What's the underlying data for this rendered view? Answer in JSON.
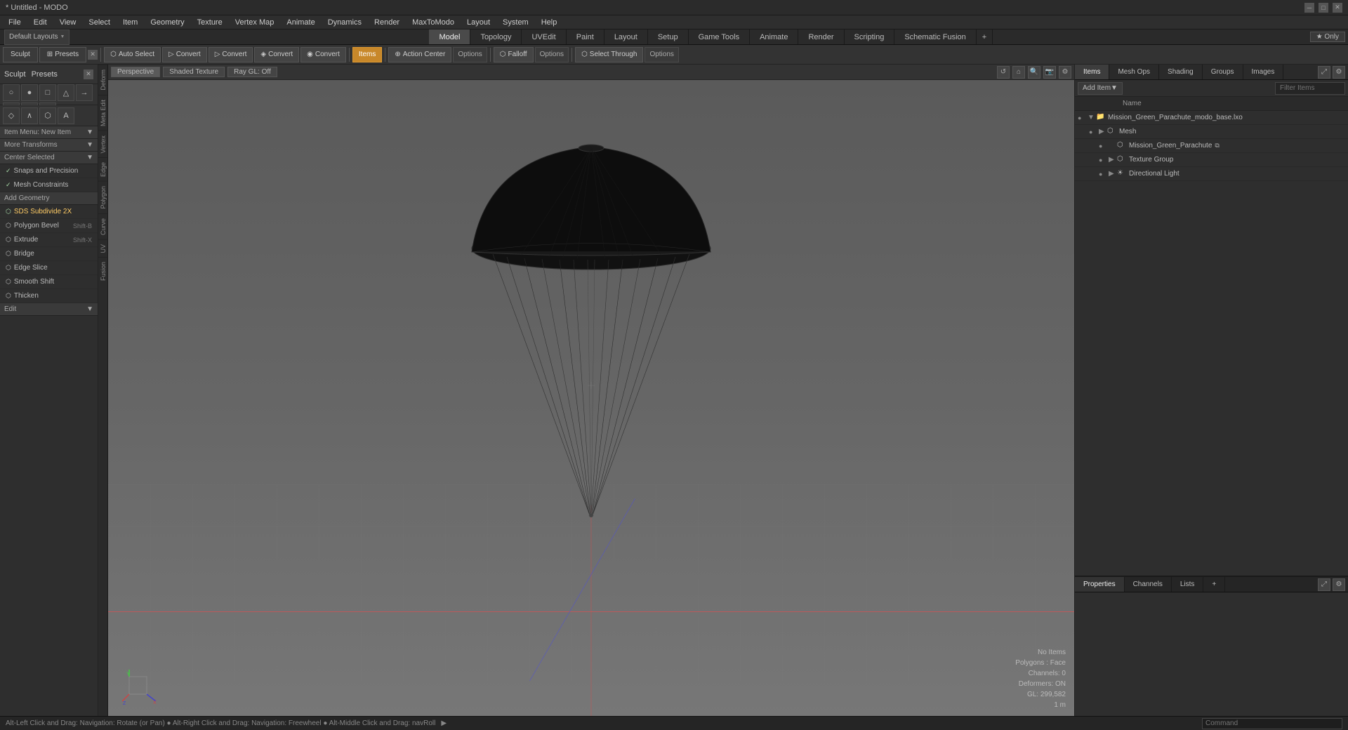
{
  "window": {
    "title": "* Untitled - MODO"
  },
  "menu": {
    "items": [
      "File",
      "Edit",
      "View",
      "Select",
      "Item",
      "Geometry",
      "Texture",
      "Vertex Map",
      "Animate",
      "Dynamics",
      "Render",
      "MaxToModo",
      "Layout",
      "System",
      "Help"
    ]
  },
  "main_tabs": {
    "items": [
      "Model",
      "Topology",
      "UVEdit",
      "Paint",
      "Layout",
      "Setup",
      "Game Tools",
      "Animate",
      "Render",
      "Scripting",
      "Schematic Fusion"
    ],
    "active": "Model",
    "add_btn": "+",
    "only_btn": "★  Only"
  },
  "toolbar": {
    "sculpt_label": "Sculpt",
    "presets_label": "Presets",
    "auto_select_label": "Auto Select",
    "convert_labels": [
      "Convert",
      "Convert",
      "Convert",
      "Convert"
    ],
    "items_label": "Items",
    "action_center_label": "Action Center",
    "options_label": "Options",
    "falloff_label": "Falloff",
    "options2_label": "Options",
    "select_through_label": "Select Through",
    "options3_label": "Options"
  },
  "viewport": {
    "tabs": [
      "Perspective",
      "Shaded Texture",
      "Ray GL: Off"
    ],
    "active_tab": "Perspective",
    "info": {
      "no_items": "No Items",
      "polygons": "Polygons : Face",
      "channels": "Channels: 0",
      "deformers": "Deformers: ON",
      "gl_coords": "GL: 299,582",
      "scale": "1 m"
    }
  },
  "left_sidebar": {
    "sculpt_header": "Sculpt",
    "presets_header": "Presets",
    "tool_sections": [
      {
        "name": "More Transforms",
        "dropdown": true
      },
      {
        "name": "Center Selected",
        "dropdown": true
      },
      {
        "name": "Snaps and Precision",
        "items": [
          "Snaps and Precision",
          "Mesh Constraints"
        ]
      },
      {
        "name": "Add Geometry",
        "items": []
      },
      {
        "name": "SDS Subdivide 2X",
        "shortcut": ""
      },
      {
        "name": "Polygon Bevel",
        "shortcut": "Shift-B"
      },
      {
        "name": "Extrude",
        "shortcut": "Shift-X"
      },
      {
        "name": "Bridge",
        "shortcut": ""
      },
      {
        "name": "Edge Slice",
        "shortcut": ""
      },
      {
        "name": "Smooth Shift",
        "shortcut": ""
      },
      {
        "name": "Thicken",
        "shortcut": ""
      }
    ],
    "edit_label": "Edit",
    "item_menu_label": "Item Menu: New Item"
  },
  "right_panel": {
    "tabs": [
      "Items",
      "Mesh Ops",
      "Shading",
      "Groups",
      "Images"
    ],
    "active_tab": "Items",
    "add_item_label": "Add Item",
    "filter_placeholder": "Filter Items",
    "name_col": "Name",
    "tree": [
      {
        "label": "Mission_Green_Parachute_modo_base.lxo",
        "icon": "folder",
        "level": 0,
        "expanded": true
      },
      {
        "label": "Mesh",
        "icon": "mesh",
        "level": 1,
        "expanded": false
      },
      {
        "label": "Mission_Green_Parachute",
        "icon": "mesh",
        "level": 2,
        "has_link": true
      },
      {
        "label": "Texture Group",
        "icon": "texture",
        "level": 2,
        "expanded": false
      },
      {
        "label": "Directional Light",
        "icon": "light",
        "level": 2,
        "expanded": false
      }
    ]
  },
  "properties_panel": {
    "tabs": [
      "Properties",
      "Channels",
      "Lists"
    ],
    "active_tab": "Properties"
  },
  "status_bar": {
    "message": "Alt-Left Click and Drag: Navigation: Rotate (or Pan) ● Alt-Right Click and Drag: Navigation: Freewheel ● Alt-Middle Click and Drag: navRoll",
    "command_placeholder": "Command"
  },
  "vert_labels": [
    "Deform",
    "Meta Edit",
    "Vertex",
    "Edge",
    "Polygon",
    "Curve",
    "UV",
    "Fusion"
  ],
  "icons": {
    "expand": "▶",
    "collapse": "▼",
    "visibility": "●",
    "star": "★",
    "add": "+",
    "close": "✕",
    "lock": "🔒",
    "gear": "⚙",
    "refresh": "↺",
    "zoom_in": "🔍",
    "camera": "📷"
  }
}
